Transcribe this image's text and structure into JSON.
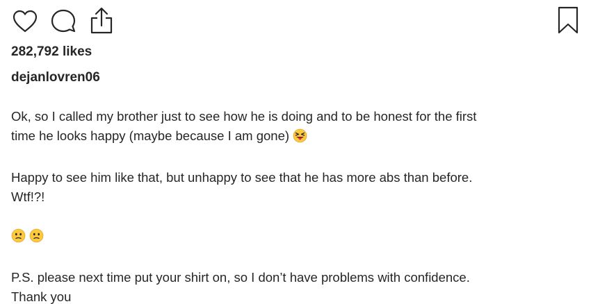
{
  "post": {
    "actions": {
      "like_icon": "heart-icon",
      "comment_icon": "comment-icon",
      "share_icon": "share-icon",
      "save_icon": "bookmark-icon"
    },
    "likes": "282,792 likes",
    "username": "dejanlovren06",
    "caption": {
      "para1": "Ok, so I called my brother just to see how he is doing and to be honest for the first\ntime he looks happy (maybe because I am gone)",
      "para1_emoji": "squinting-tongue-emoji",
      "para2": "Happy to see him like that, but unhappy to see that he has more abs than before.\nWtf!?!",
      "para3_emojis": [
        "confused-face-emoji",
        "confused-face-emoji"
      ],
      "para4": "P.S. please next time put your shirt on, so I don’t have problems with confidence.\nThank you"
    }
  },
  "colors": {
    "text": "#262626",
    "icon_stroke": "#262626",
    "emoji_yellow": "#FFC83D",
    "emoji_tongue": "#E0245E"
  }
}
